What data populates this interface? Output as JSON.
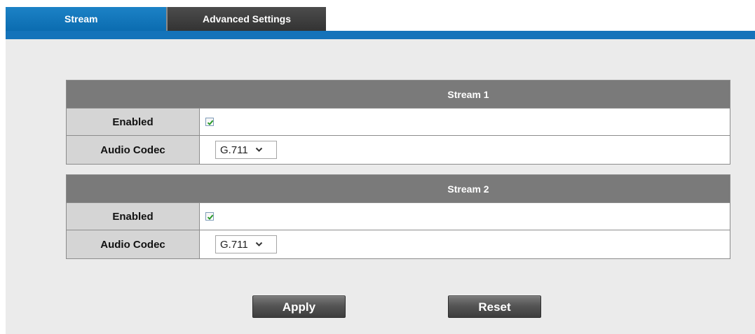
{
  "tabs": [
    {
      "label": "Stream",
      "active": true
    },
    {
      "label": "Advanced Settings",
      "active": false
    }
  ],
  "streams": [
    {
      "title": "Stream 1",
      "enabled_label": "Enabled",
      "enabled": true,
      "codec_label": "Audio Codec",
      "codec_value": "G.711"
    },
    {
      "title": "Stream 2",
      "enabled_label": "Enabled",
      "enabled": true,
      "codec_label": "Audio Codec",
      "codec_value": "G.711"
    }
  ],
  "buttons": {
    "apply": "Apply",
    "reset": "Reset"
  },
  "colors": {
    "active_tab": "#0b6cb0",
    "inactive_tab": "#3a3a3a",
    "checkmark": "#2a9a2a"
  },
  "icons": {
    "checkbox": "checkmark-icon",
    "dropdown": "chevron-down-icon"
  }
}
